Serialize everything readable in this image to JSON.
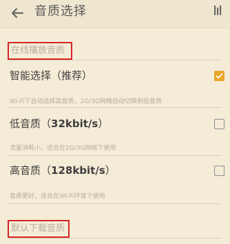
{
  "header": {
    "title": "音质选择",
    "back_icon": "arrow-left-icon",
    "right_icon": "equalizer-icon"
  },
  "sections": [
    {
      "label": "在线播放音质",
      "options": [
        {
          "title": "智能选择（推荐）",
          "bitrate": "",
          "description": "Wi-Fi下自动选择高音质，2G/3G网络自动切换到低音质",
          "checked": true
        },
        {
          "title": "低音质（",
          "bitrate": "32kbit/s",
          "title_suffix": "）",
          "description": "流量消耗小，适合在2G/3G网络下使用",
          "checked": false
        },
        {
          "title": "高音质（",
          "bitrate": "128kbit/s",
          "title_suffix": "）",
          "description": "音质更好，适合在Wi-Fi环境下使用",
          "checked": false
        }
      ]
    },
    {
      "label": "默认下载音质"
    }
  ],
  "colors": {
    "background": "#f4ecd7",
    "accent": "#e6a62c",
    "highlight_box": "#d42424"
  }
}
